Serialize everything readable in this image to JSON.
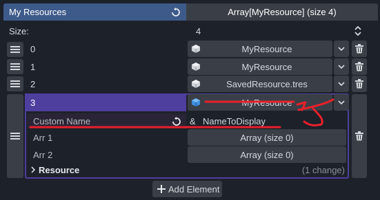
{
  "header": {
    "title": "My Resources",
    "value": "Array[MyResource] (size 4)"
  },
  "size_row": {
    "label": "Size:",
    "value": "4"
  },
  "items": [
    {
      "index": "0",
      "value": "MyResource"
    },
    {
      "index": "1",
      "value": "MyResource"
    },
    {
      "index": "2",
      "value": "SavedResource.tres"
    },
    {
      "index": "3",
      "value": "MyResource"
    }
  ],
  "expanded": {
    "custom_name_label": "Custom Name",
    "custom_name_prefix": "&",
    "custom_name_value": "NameToDisplay",
    "arr1_label": "Arr 1",
    "arr1_value": "Array (size 0)",
    "arr2_label": "Arr 2",
    "arr2_value": "Array (size 0)",
    "resource_label": "Resource",
    "resource_changes": "(1 change)"
  },
  "footer": {
    "add_label": "Add Element"
  },
  "colors": {
    "header_blue": "#3d5a8a",
    "selected_purple": "#4e3f9e",
    "annotation_red": "#e8202a"
  }
}
